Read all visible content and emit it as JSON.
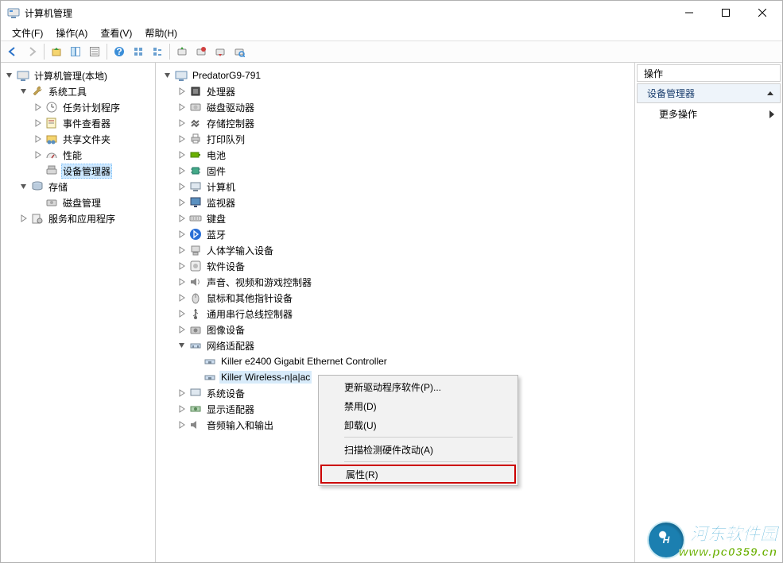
{
  "window": {
    "title": "计算机管理",
    "controls": {
      "min": "—",
      "max": "▢",
      "close": "✕"
    }
  },
  "menu": {
    "file": "文件(F)",
    "action": "操作(A)",
    "view": "查看(V)",
    "help": "帮助(H)"
  },
  "left_tree": {
    "root": "计算机管理(本地)",
    "system_tools": "系统工具",
    "task_scheduler": "任务计划程序",
    "event_viewer": "事件查看器",
    "shared_folders": "共享文件夹",
    "performance": "性能",
    "device_manager": "设备管理器",
    "storage": "存储",
    "disk_mgmt": "磁盘管理",
    "services_apps": "服务和应用程序"
  },
  "center_tree": {
    "root": "PredatorG9-791",
    "cpu": "处理器",
    "disk_drives": "磁盘驱动器",
    "storage_ctrl": "存储控制器",
    "print_queue": "打印队列",
    "battery": "电池",
    "firmware": "固件",
    "computer": "计算机",
    "monitor": "监视器",
    "keyboard": "键盘",
    "bluetooth": "蓝牙",
    "hid": "人体学输入设备",
    "software_dev": "软件设备",
    "sound": "声音、视频和游戏控制器",
    "mouse": "鼠标和其他指针设备",
    "usb": "通用串行总线控制器",
    "imaging": "图像设备",
    "netadapter": "网络适配器",
    "net1": "Killer e2400 Gigabit Ethernet Controller",
    "net2": "Killer Wireless-n|a|ac",
    "system_dev": "系统设备",
    "display": "显示适配器",
    "audio_io": "音频输入和输出"
  },
  "context_menu": {
    "update_driver": "更新驱动程序软件(P)...",
    "disable": "禁用(D)",
    "uninstall": "卸载(U)",
    "scan": "扫描检测硬件改动(A)",
    "properties": "属性(R)"
  },
  "actions_pane": {
    "header": "操作",
    "section": "设备管理器",
    "more": "更多操作"
  },
  "watermark": {
    "line1": "河东软件园",
    "line2": "www.pc0359.cn",
    "badge": "H"
  }
}
